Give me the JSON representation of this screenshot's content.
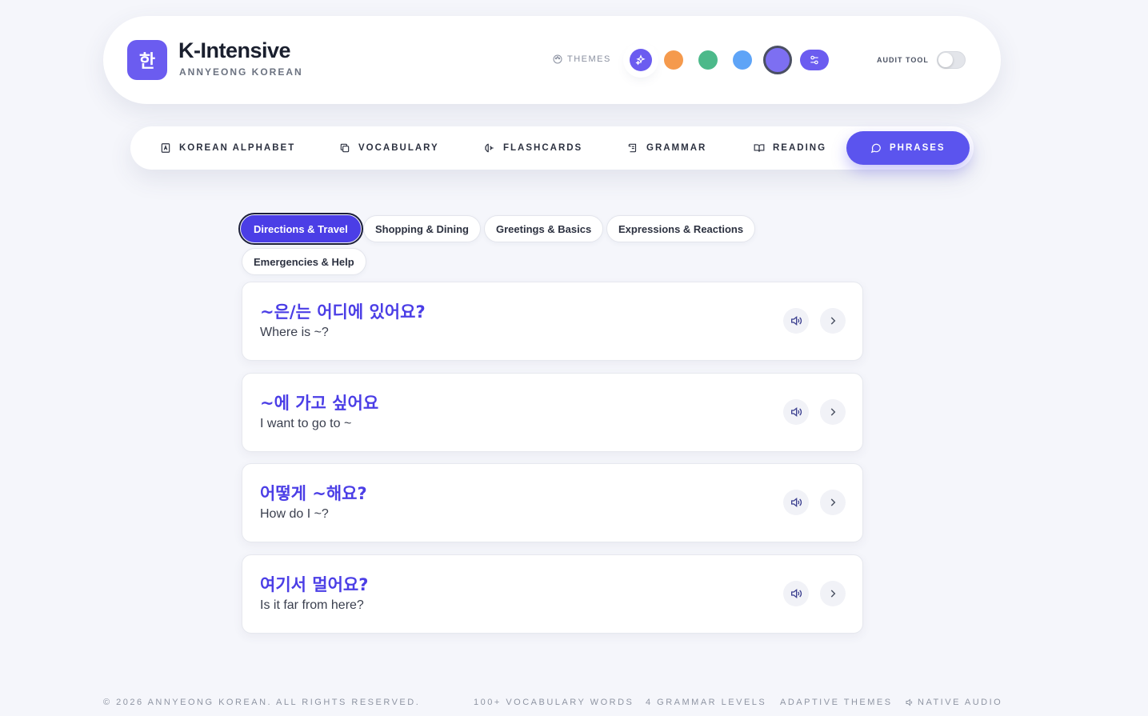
{
  "brand": {
    "logo_glyph": "한",
    "title": "K-Intensive",
    "subtitle": "ANNYEONG KOREAN"
  },
  "themes": {
    "label": "THEMES",
    "swatches": [
      {
        "name": "indigo-sparkle",
        "color": "#6b5cf0"
      },
      {
        "name": "orange",
        "color": "#f59a4d"
      },
      {
        "name": "green",
        "color": "#4cb98a"
      },
      {
        "name": "blue",
        "color": "#5ea4f7"
      },
      {
        "name": "violet",
        "color": "#7d6ff2"
      }
    ],
    "selected": "violet"
  },
  "audit": {
    "label": "AUDIT TOOL",
    "enabled": false
  },
  "nav": {
    "items": [
      {
        "label": "KOREAN ALPHABET",
        "icon": "alphabet-icon"
      },
      {
        "label": "VOCABULARY",
        "icon": "copy-icon"
      },
      {
        "label": "FLASHCARDS",
        "icon": "brain-icon"
      },
      {
        "label": "GRAMMAR",
        "icon": "scroll-icon"
      },
      {
        "label": "READING",
        "icon": "book-open-icon"
      },
      {
        "label": "PHRASES",
        "icon": "message-circle-icon"
      }
    ],
    "active": "PHRASES"
  },
  "categories": {
    "items": [
      "Directions & Travel",
      "Shopping & Dining",
      "Greetings & Basics",
      "Expressions & Reactions",
      "Emergencies & Help"
    ],
    "active": "Directions & Travel"
  },
  "phrases": [
    {
      "korean": "~은/는 어디에 있어요?",
      "english": "Where is ~?"
    },
    {
      "korean": "~에 가고 싶어요",
      "english": "I want to go to ~"
    },
    {
      "korean": "어떻게 ~해요?",
      "english": "How do I ~?"
    },
    {
      "korean": "여기서 멀어요?",
      "english": "Is it far from here?"
    }
  ],
  "footer": {
    "copyright": "© 2026 ANNYEONG KOREAN. ALL RIGHTS RESERVED.",
    "stats": [
      "100+ VOCABULARY WORDS",
      "4 GRAMMAR LEVELS",
      "ADAPTIVE THEMES",
      "NATIVE AUDIO"
    ]
  },
  "colors": {
    "accent": "#5b54ee",
    "accent_dark": "#4b3ee6",
    "background": "#f5f6fb"
  }
}
